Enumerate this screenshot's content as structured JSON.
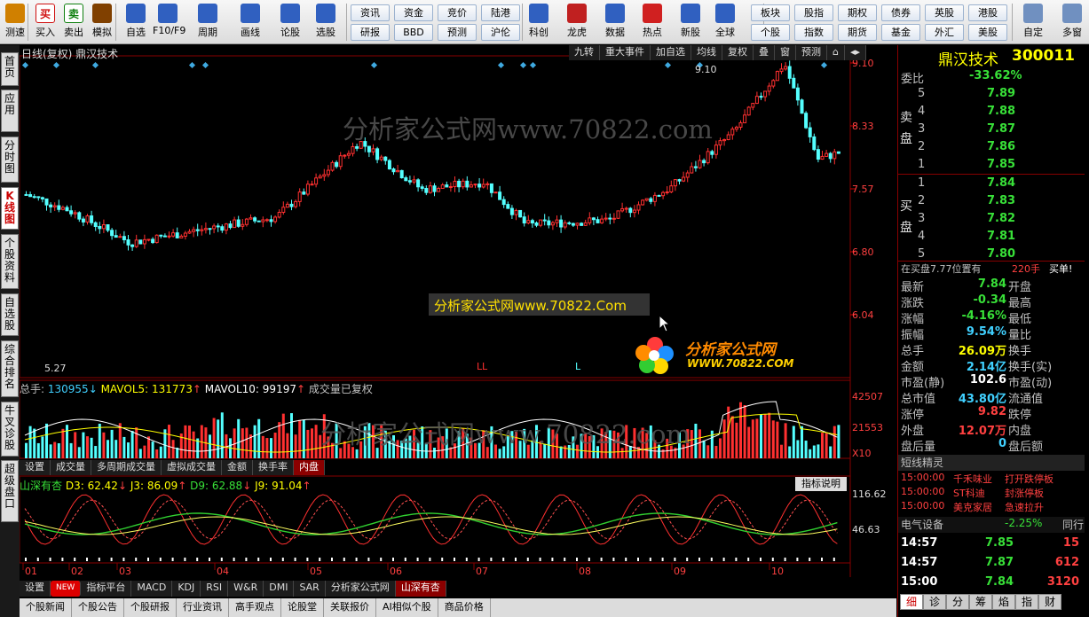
{
  "toolbar": {
    "buttons": [
      {
        "label": "测速",
        "icon": "clock-icon",
        "color": "#d08000"
      },
      {
        "label": "买入",
        "icon": "buy-icon",
        "glyph": "买",
        "color": "#d01010"
      },
      {
        "label": "卖出",
        "icon": "sell-icon",
        "glyph": "卖",
        "color": "#108010"
      },
      {
        "label": "模拟",
        "icon": "hammer-icon",
        "color": "#804000"
      },
      {
        "label": "自选",
        "icon": "star-icon",
        "color": "#3060c0"
      },
      {
        "label": "F10/F9",
        "icon": "f10-icon",
        "color": "#3060c0"
      },
      {
        "label": "周期",
        "icon": "period-icon",
        "color": "#3060c0"
      },
      {
        "label": "画线",
        "icon": "pencil-icon",
        "color": "#3060c0"
      },
      {
        "label": "论股",
        "icon": "discuss-icon",
        "color": "#3060c0"
      },
      {
        "label": "选股",
        "icon": "select-stock-icon",
        "color": "#3060c0"
      }
    ],
    "keys": [
      "资讯",
      "资金",
      "竞价",
      "陆港",
      "研报",
      "BBD",
      "预测",
      "沪伦"
    ],
    "buttons2": [
      {
        "label": "科创",
        "icon": "kechuang-icon",
        "color": "#3060c0"
      },
      {
        "label": "龙虎",
        "icon": "longhu-icon",
        "color": "#c02020"
      },
      {
        "label": "数据",
        "icon": "pe-icon",
        "color": "#3060c0"
      },
      {
        "label": "热点",
        "icon": "hot-icon",
        "color": "#d02020"
      },
      {
        "label": "新股",
        "icon": "ipo-icon",
        "color": "#3060c0"
      },
      {
        "label": "全球",
        "icon": "globe-icon",
        "color": "#3060c0"
      }
    ],
    "keys2": [
      "板块",
      "股指",
      "期权",
      "债券",
      "英股",
      "港股",
      "个股",
      "指数",
      "期货",
      "基金",
      "外汇",
      "美股"
    ],
    "buttons3": [
      {
        "label": "自定",
        "icon": "custom-icon"
      },
      {
        "label": "多窗",
        "icon": "multiwindow-icon"
      }
    ]
  },
  "left_tabs": [
    "首页",
    "应用",
    "分时图",
    "K线图",
    "个股资料",
    "自选股",
    "综合排名",
    "牛叉诊股",
    "超级盘口"
  ],
  "chart": {
    "title": "日线(复权) 鼎汉技术",
    "tools": [
      "九转",
      "重大事件",
      "加自选",
      "均线",
      "复权",
      "叠",
      "窗",
      "预测"
    ],
    "price_ticks": [
      "9.10",
      "8.33",
      "7.57",
      "6.80",
      "6.04"
    ],
    "high_label": "9.10",
    "low_label": "5.27",
    "watermark": "分析家公式网www.70822.com",
    "popup_text": "分析家公式网www.70822.Com",
    "logo_text": "分析家公式网",
    "logo_url": "WWW.70822.COM",
    "volume_legend": {
      "total_label": "总手:",
      "total": "130955",
      "ma5_label": "MAVOL5:",
      "ma5": "131773",
      "ma10_label": "MAVOL10:",
      "ma10": "99197",
      "note": "成交量已复权"
    },
    "volume_ticks": [
      "42507",
      "21553",
      "X10"
    ],
    "mid_buttons": [
      "设置",
      "成交量",
      "多周期成交量",
      "虚拟成交量",
      "金额",
      "换手率",
      "内盘"
    ],
    "indicator_legend": {
      "name": "山深有杏",
      "d3": "D3: 62.42",
      "j3": "J3: 86.09",
      "d9": "D9: 62.88",
      "j9": "J9: 91.04"
    },
    "indicator_button": "指标说明",
    "indicator_ticks": [
      "116.62",
      "46.63"
    ],
    "months": [
      "01",
      "02",
      "03",
      "04",
      "05",
      "06",
      "07",
      "08",
      "09",
      "10"
    ],
    "bottom_buttons": [
      "设置",
      "NEW",
      "指标平台",
      "MACD",
      "KDJ",
      "RSI",
      "W&R",
      "DMI",
      "SAR",
      "分析家公式网",
      "山深有杏"
    ],
    "bottom_tabs": [
      "个股新闻",
      "个股公告",
      "个股研报",
      "行业资讯",
      "高手观点",
      "论股堂",
      "关联报价",
      "AI相似个股",
      "商品价格"
    ]
  },
  "quote": {
    "name": "鼎汉技术",
    "code": "300011",
    "weibi_label": "委比",
    "weibi": "-33.62%",
    "sell_label": "卖盘",
    "buy_label": "买盘",
    "sells": [
      {
        "n": "5",
        "p": "7.89"
      },
      {
        "n": "4",
        "p": "7.88"
      },
      {
        "n": "3",
        "p": "7.87"
      },
      {
        "n": "2",
        "p": "7.86"
      },
      {
        "n": "1",
        "p": "7.85"
      }
    ],
    "buys": [
      {
        "n": "1",
        "p": "7.84"
      },
      {
        "n": "2",
        "p": "7.83"
      },
      {
        "n": "3",
        "p": "7.82"
      },
      {
        "n": "4",
        "p": "7.81"
      },
      {
        "n": "5",
        "p": "7.80"
      }
    ],
    "notice": "在买盘7.77位置有",
    "notice_qty": "220手",
    "notice_tail": "买单!",
    "stats": [
      {
        "l": "最新",
        "v": "7.84",
        "c": "grn",
        "r": "开盘"
      },
      {
        "l": "涨跌",
        "v": "-0.34",
        "c": "grn",
        "r": "最高"
      },
      {
        "l": "涨幅",
        "v": "-4.16%",
        "c": "grn",
        "r": "最低"
      },
      {
        "l": "振幅",
        "v": "9.54%",
        "c": "cyn",
        "r": "量比"
      },
      {
        "l": "总手",
        "v": "26.09万",
        "c": "yel",
        "r": "换手"
      },
      {
        "l": "金额",
        "v": "2.14亿",
        "c": "cyn",
        "r": "换手(实)"
      },
      {
        "l": "市盈(静)",
        "v": "102.6",
        "c": "wht",
        "r": "市盈(动)"
      },
      {
        "l": "总市值",
        "v": "43.80亿",
        "c": "cyn",
        "r": "流通值"
      },
      {
        "l": "涨停",
        "v": "9.82",
        "c": "red",
        "r": "跌停"
      },
      {
        "l": "外盘",
        "v": "12.07万",
        "c": "red",
        "r": "内盘"
      },
      {
        "l": "盘后量",
        "v": "0",
        "c": "cyn",
        "r": "盘后额"
      }
    ],
    "short_title": "短线精灵",
    "short_items": [
      {
        "t": "15:00:00",
        "n": "千禾味业",
        "e": "打开跌停板"
      },
      {
        "t": "15:00:00",
        "n": "ST科迪",
        "e": "封涨停板"
      },
      {
        "t": "15:00:00",
        "n": "美克家居",
        "e": "急速拉升"
      }
    ],
    "sector": "电气设备",
    "sector_pct": "-2.25%",
    "sector_tail": "同行",
    "ticks": [
      {
        "t": "14:57",
        "p": "7.85",
        "v": "15"
      },
      {
        "t": "14:57",
        "p": "7.87",
        "v": "612"
      },
      {
        "t": "15:00",
        "p": "7.84",
        "v": "3120"
      }
    ],
    "tabs": [
      "细",
      "诊",
      "分",
      "筹",
      "焰",
      "指",
      "财"
    ]
  }
}
